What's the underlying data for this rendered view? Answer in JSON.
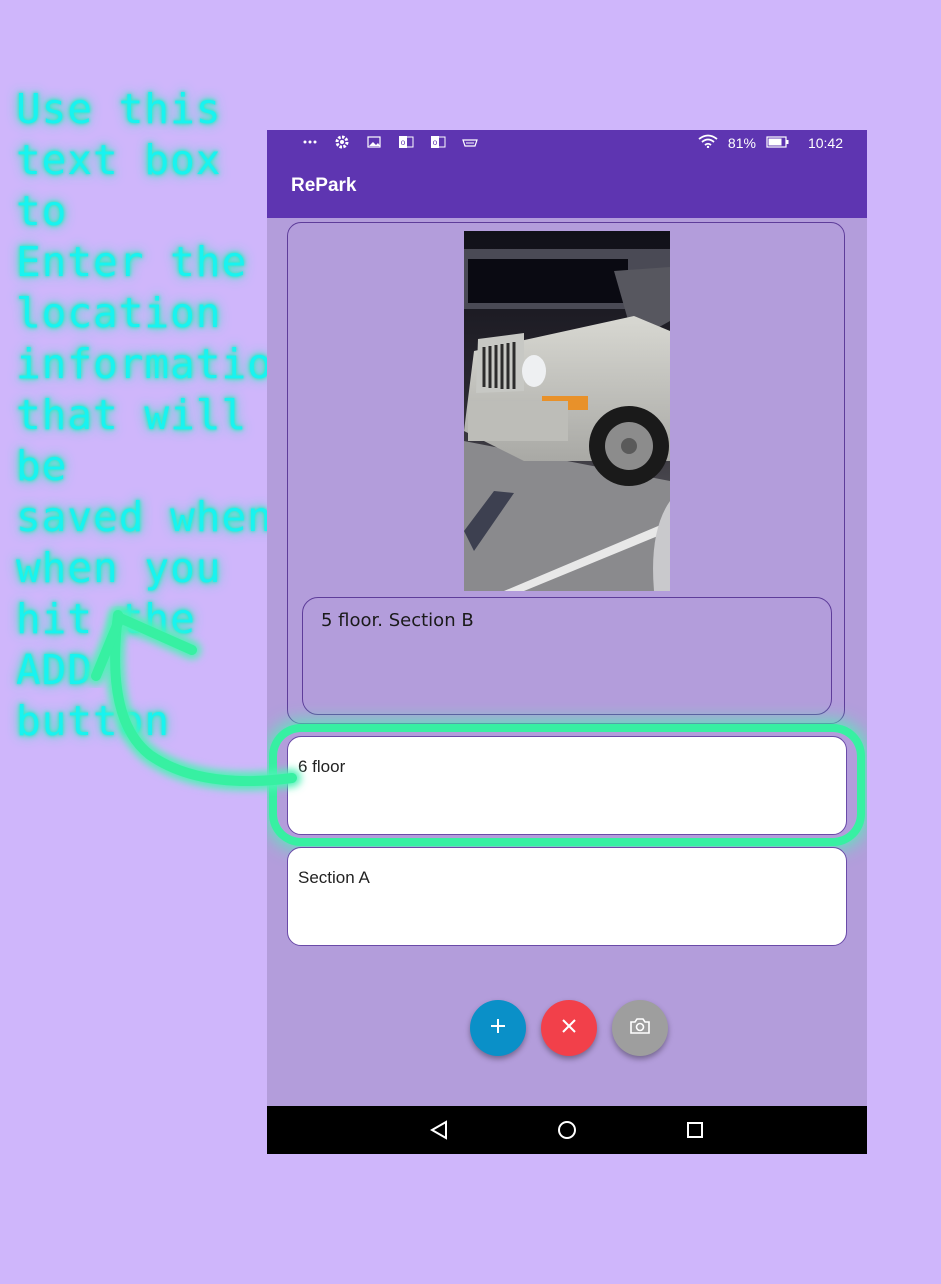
{
  "annotation": {
    "lines": [
      "Use this",
      "text box to",
      "Enter the",
      "location",
      "information",
      "that will be",
      "saved when",
      "when you",
      "hit the ADD",
      "button"
    ]
  },
  "status_bar": {
    "battery": "81%",
    "time": "10:42",
    "icons": [
      "more-icon",
      "settings-icon",
      "image-icon",
      "outlook-icon",
      "outlook-icon",
      "amazon-icon",
      "wifi-icon",
      "battery-icon"
    ]
  },
  "app_bar": {
    "title": "RePark"
  },
  "saved_entry": {
    "note": "5 floor. Section B"
  },
  "floor_input": {
    "value": "6 floor"
  },
  "section_input": {
    "value": "Section A"
  },
  "actions": {
    "add": {
      "icon": "plus-icon",
      "color": "#0a90c8"
    },
    "cancel": {
      "icon": "close-icon",
      "color": "#f2404a"
    },
    "camera": {
      "icon": "camera-icon",
      "color": "#9e9e9e"
    }
  },
  "nav_bar": {
    "icons": [
      "back-icon",
      "home-icon",
      "recents-icon"
    ]
  },
  "colors": {
    "primary": "#5e35b1",
    "background": "#b39ddb",
    "annotation": "#18f3f0",
    "highlight": "#37f0a2"
  }
}
